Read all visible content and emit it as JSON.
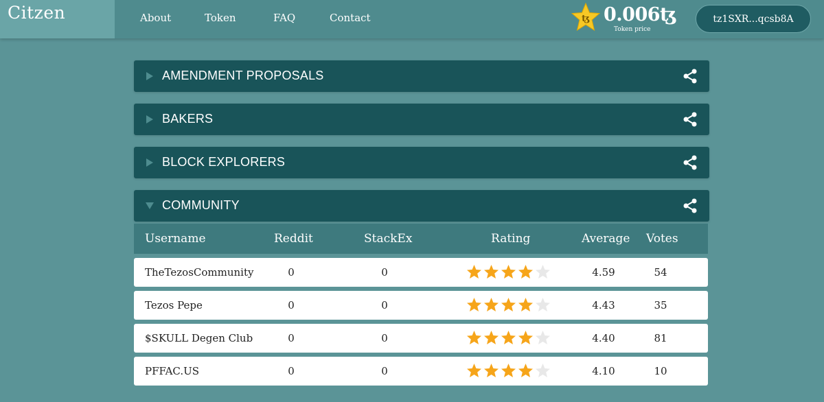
{
  "header": {
    "logo": "Citzen",
    "nav": [
      "About",
      "Token",
      "FAQ",
      "Contact"
    ],
    "token_price": "0.006ꜩ",
    "token_price_label": "Token price",
    "wallet_address": "tz1SXR...qcsb8A",
    "star_color": "#f7c825"
  },
  "sections": [
    {
      "title": "AMENDMENT PROPOSALS",
      "expanded": false
    },
    {
      "title": "BAKERS",
      "expanded": false
    },
    {
      "title": "BLOCK EXPLORERS",
      "expanded": false
    },
    {
      "title": "COMMUNITY",
      "expanded": true
    }
  ],
  "table": {
    "headers": [
      "Username",
      "Reddit",
      "StackEx",
      "Rating",
      "Average",
      "Votes"
    ],
    "rows": [
      {
        "username": "TheTezosCommunity",
        "reddit": "0",
        "stackex": "0",
        "rating_stars": 4,
        "average": "4.59",
        "votes": "54"
      },
      {
        "username": "Tezos Pepe",
        "reddit": "0",
        "stackex": "0",
        "rating_stars": 4,
        "average": "4.43",
        "votes": "35"
      },
      {
        "username": "$SKULL Degen Club",
        "reddit": "0",
        "stackex": "0",
        "rating_stars": 4,
        "average": "4.40",
        "votes": "81"
      },
      {
        "username": "PFFAC.US",
        "reddit": "0",
        "stackex": "0",
        "rating_stars": 4,
        "average": "4.10",
        "votes": "10"
      }
    ]
  },
  "colors": {
    "background": "#5b9497",
    "section_bar": "#195459",
    "table_header": "#3e7a7e",
    "star_filled": "#f6a51a",
    "star_empty": "#e8e8e8"
  }
}
